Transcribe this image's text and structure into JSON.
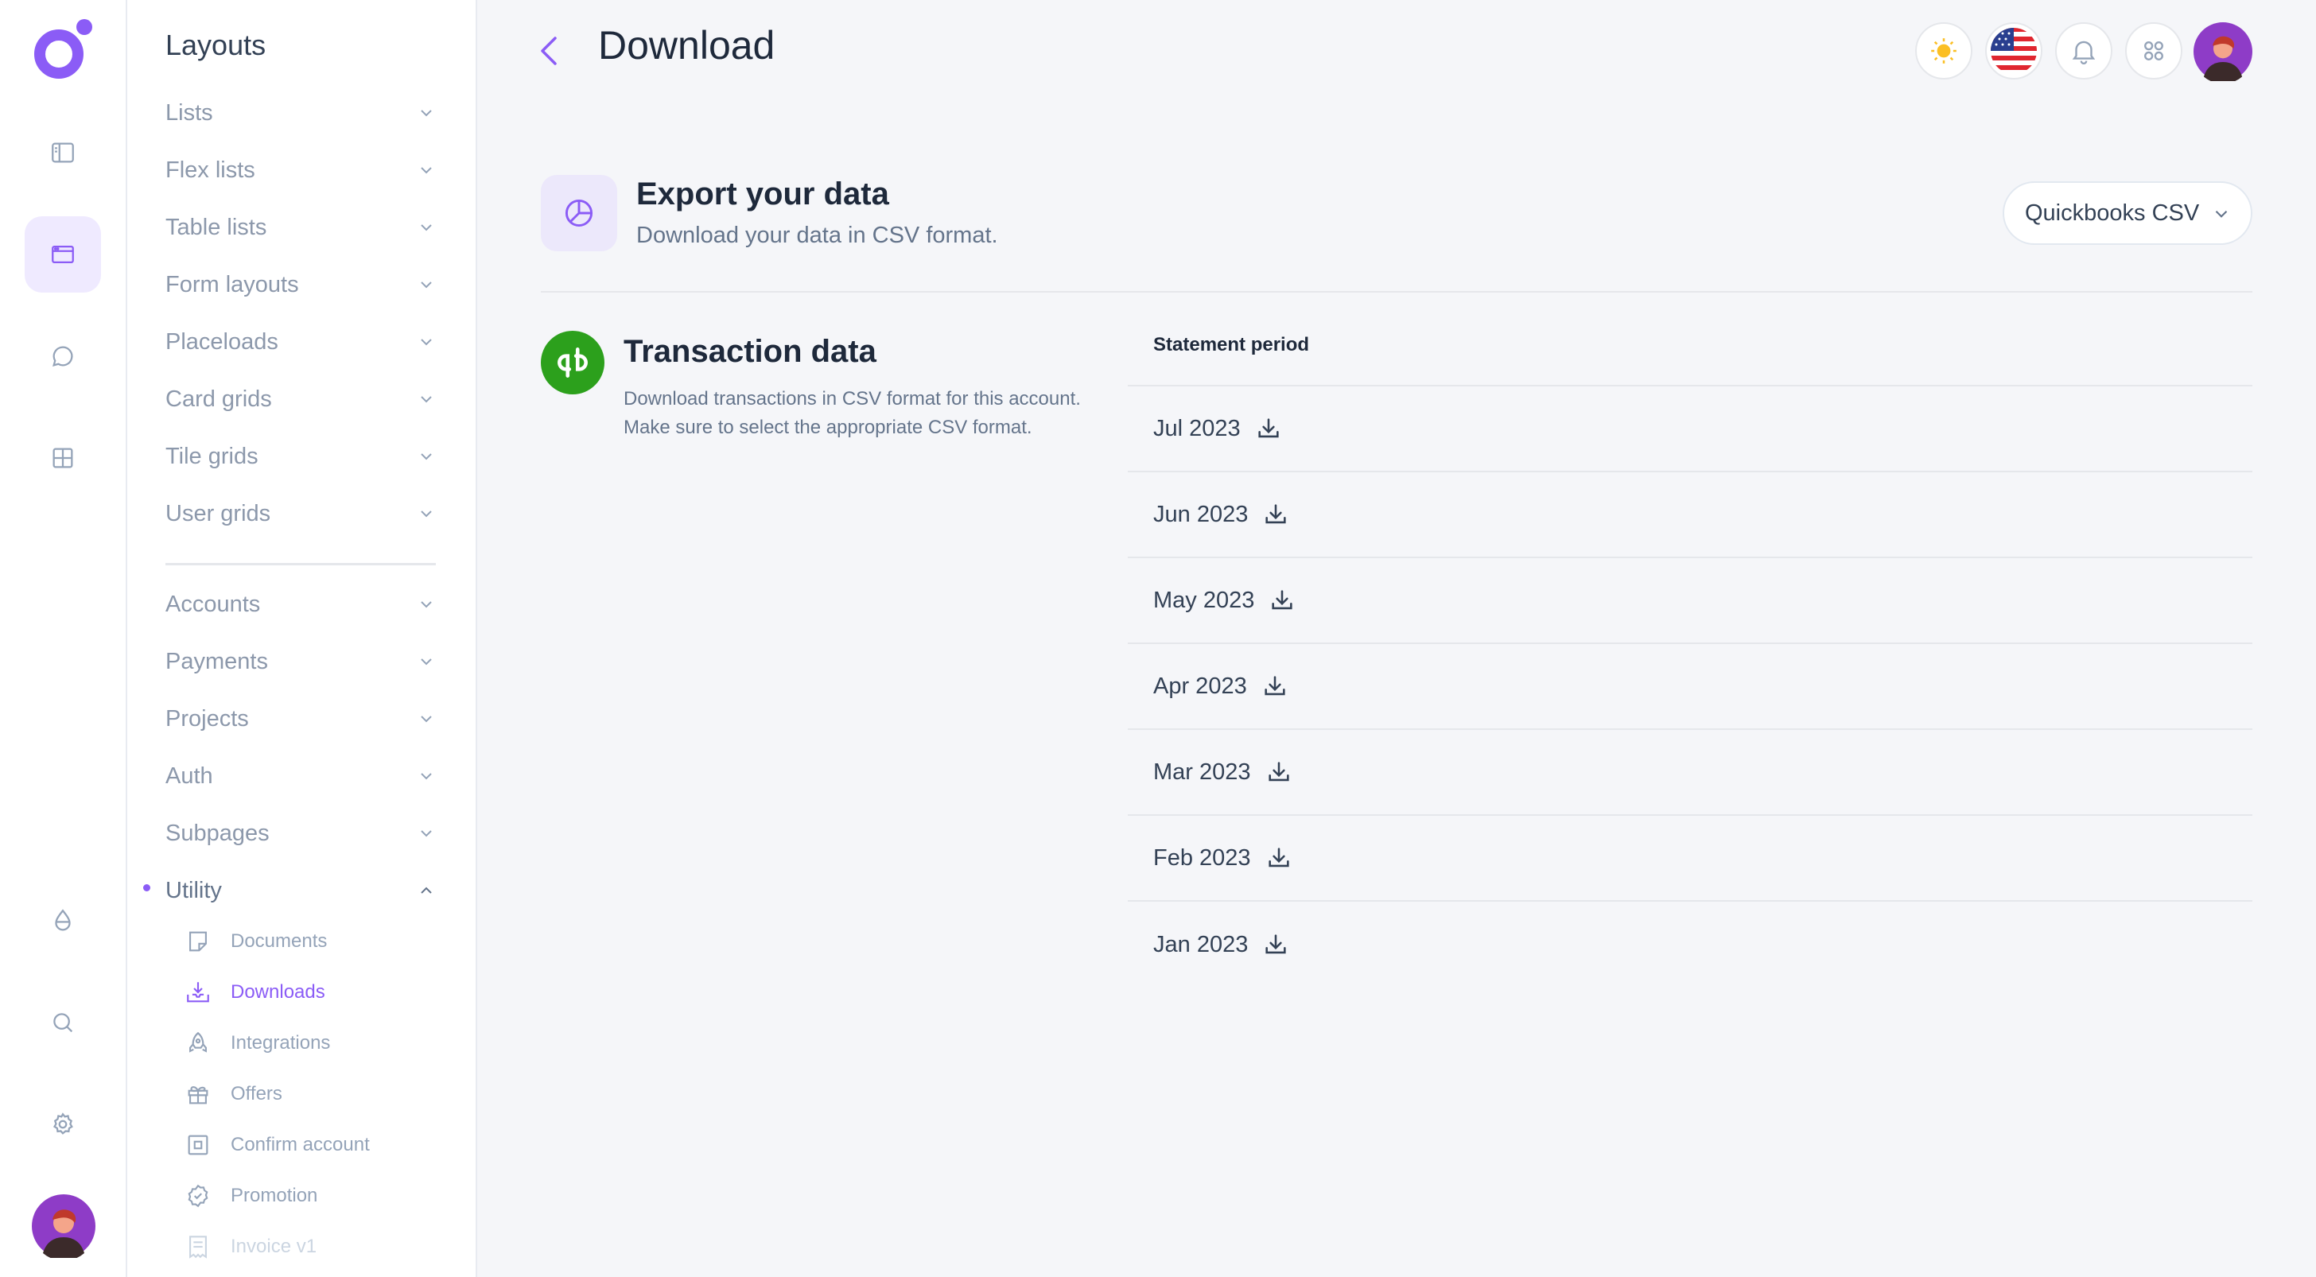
{
  "sidebar": {
    "title": "Layouts",
    "groups": [
      {
        "label": "Lists"
      },
      {
        "label": "Flex lists"
      },
      {
        "label": "Table lists"
      },
      {
        "label": "Form layouts"
      },
      {
        "label": "Placeloads"
      },
      {
        "label": "Card grids"
      },
      {
        "label": "Tile grids"
      },
      {
        "label": "User grids"
      },
      {
        "label": "Accounts"
      },
      {
        "label": "Payments"
      },
      {
        "label": "Projects"
      },
      {
        "label": "Auth"
      },
      {
        "label": "Subpages"
      },
      {
        "label": "Utility"
      }
    ],
    "utility_items": [
      {
        "label": "Documents",
        "icon": "document-icon"
      },
      {
        "label": "Downloads",
        "icon": "download-tray-icon"
      },
      {
        "label": "Integrations",
        "icon": "rocket-icon"
      },
      {
        "label": "Offers",
        "icon": "gift-icon"
      },
      {
        "label": "Confirm account",
        "icon": "square-check-icon"
      },
      {
        "label": "Promotion",
        "icon": "badge-icon"
      },
      {
        "label": "Invoice v1",
        "icon": "invoice-icon"
      }
    ]
  },
  "header": {
    "title": "Download"
  },
  "export": {
    "title": "Export your data",
    "subtitle": "Download your data in CSV format.",
    "format_selected": "Quickbooks CSV"
  },
  "transactions": {
    "title": "Transaction data",
    "description": "Download transactions in CSV format for this account. Make sure to select the appropriate CSV format.",
    "column_header": "Statement period",
    "periods": [
      "Jul 2023",
      "Jun 2023",
      "May 2023",
      "Apr 2023",
      "Mar 2023",
      "Feb 2023",
      "Jan 2023"
    ]
  },
  "colors": {
    "accent": "#8b5cf6",
    "quickbooks_green": "#2ca01c",
    "sun": "#fbbf24"
  }
}
